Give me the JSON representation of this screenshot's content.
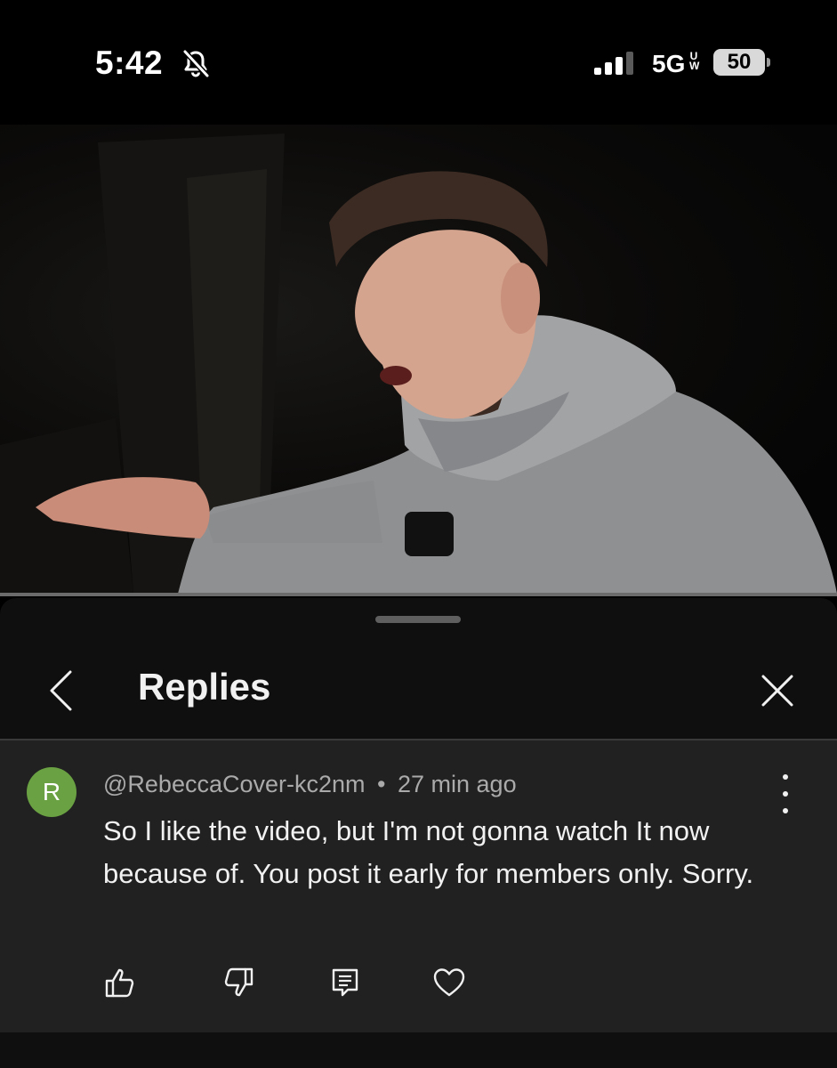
{
  "status_bar": {
    "time": "5:42",
    "network": "5G",
    "network_sup": "UW",
    "battery": "50",
    "icons": [
      "bell-muted-icon",
      "signal-icon"
    ]
  },
  "video": {
    "progress": 0.0
  },
  "sheet": {
    "title": "Replies",
    "icons": [
      "chevron-left-icon",
      "close-icon"
    ]
  },
  "comment": {
    "avatar_letter": "R",
    "avatar_color": "#6aa142",
    "author": "@RebeccaCover-kc2nm",
    "separator": "•",
    "time_ago": "27 min ago",
    "text": "So I like the video, but I'm not gonna watch It now because of. You post it early for members only. Sorry.",
    "actions": [
      "thumbs-up-icon",
      "thumbs-down-icon",
      "reply-icon",
      "heart-icon"
    ]
  }
}
